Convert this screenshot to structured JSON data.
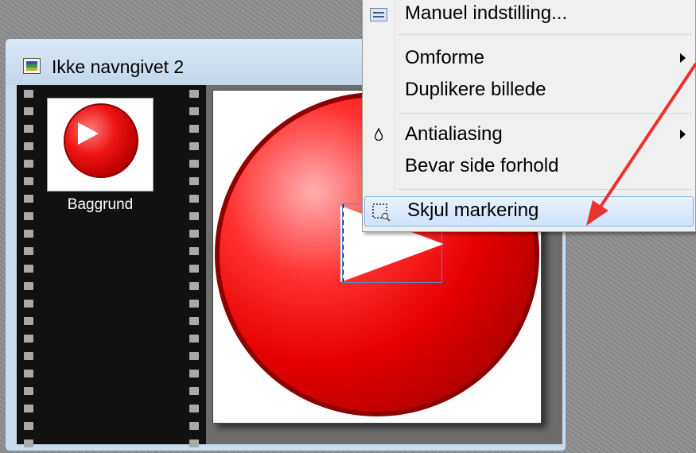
{
  "window": {
    "title": "Ikke navngivet 2"
  },
  "layers": {
    "thumbnail_label": "Baggrund"
  },
  "context_menu": {
    "items": [
      {
        "label": "Manuel indstilling...",
        "icon": "manual-settings-icon",
        "submenu": false
      },
      {
        "label": "Omforme",
        "icon": null,
        "submenu": true
      },
      {
        "label": "Duplikere billede",
        "icon": null,
        "submenu": false
      },
      {
        "label": "Antialiasing",
        "icon": "drop-icon",
        "submenu": true
      },
      {
        "label": "Bevar side forhold",
        "icon": null,
        "submenu": false
      },
      {
        "label": "Skjul markering",
        "icon": "selection-icon",
        "submenu": false,
        "highlighted": true
      }
    ]
  },
  "colors": {
    "annotation_arrow": "#e8332f",
    "menu_highlight": "#cde2fb",
    "image_red": "#e40000"
  }
}
